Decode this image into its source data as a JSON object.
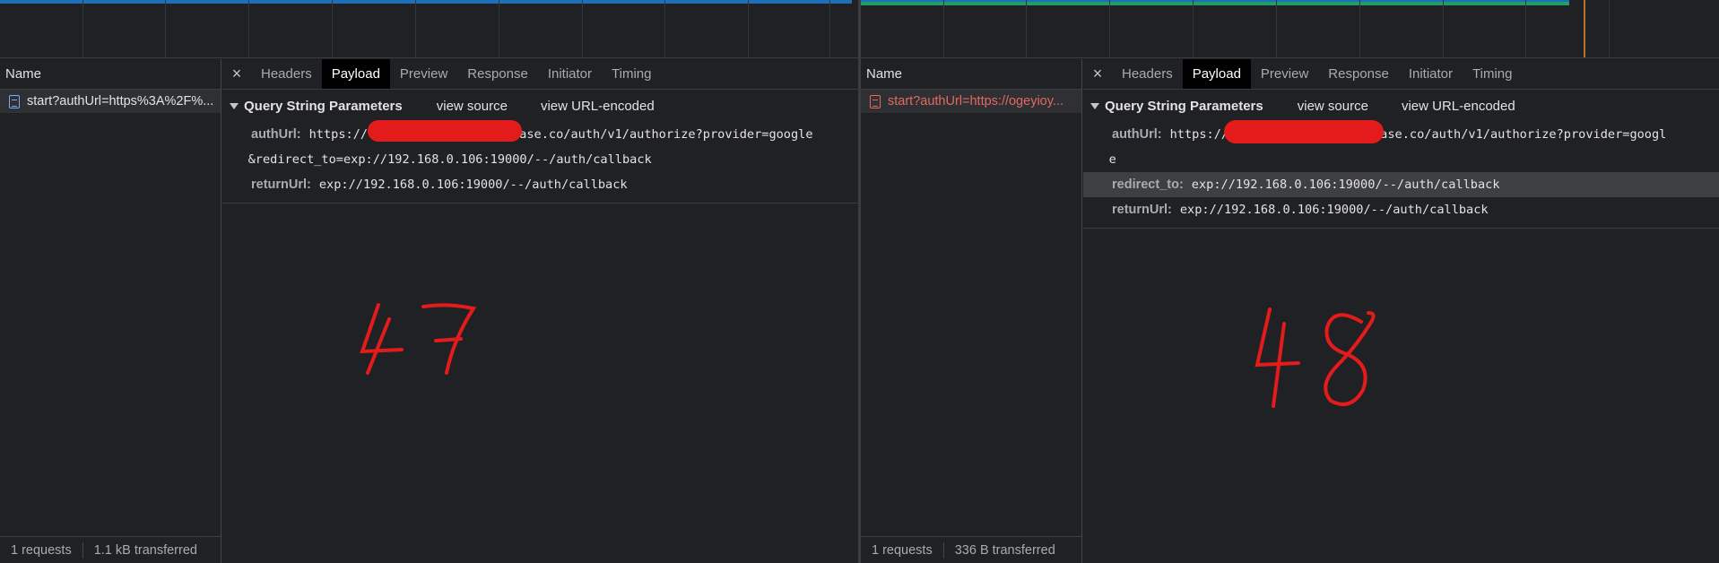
{
  "left": {
    "name_header": "Name",
    "request": {
      "label": "start?authUrl=https%3A%2F%..."
    },
    "status": {
      "requests": "1 requests",
      "transferred": "1.1 kB transferred"
    },
    "tabs": {
      "close": "×",
      "headers": "Headers",
      "payload": "Payload",
      "preview": "Preview",
      "response": "Response",
      "initiator": "Initiator",
      "timing": "Timing"
    },
    "section": {
      "title": "Query String Parameters",
      "view_source": "view source",
      "view_encoded": "view URL-encoded"
    },
    "params": {
      "auth_key": "authUrl:",
      "auth_val_1": "https://",
      "auth_val_2": ".supabase.co/auth/v1/authorize?provider=google",
      "auth_val_3": "&redirect_to=exp://192.168.0.106:19000/--/auth/callback",
      "return_key": "returnUrl:",
      "return_val": "exp://192.168.0.106:19000/--/auth/callback"
    },
    "annotation": "47"
  },
  "right": {
    "name_header": "Name",
    "request": {
      "label": "start?authUrl=https://ogeyioy..."
    },
    "status": {
      "requests": "1 requests",
      "transferred": "336 B transferred"
    },
    "tabs": {
      "close": "×",
      "headers": "Headers",
      "payload": "Payload",
      "preview": "Preview",
      "response": "Response",
      "initiator": "Initiator",
      "timing": "Timing"
    },
    "section": {
      "title": "Query String Parameters",
      "view_source": "view source",
      "view_encoded": "view URL-encoded"
    },
    "params": {
      "auth_key": "authUrl:",
      "auth_val_1": "https://",
      "auth_val_2": ".supabase.co/auth/v1/authorize?provider=googl",
      "auth_val_3": "e",
      "redirect_key": "redirect_to:",
      "redirect_val": "exp://192.168.0.106:19000/--/auth/callback",
      "return_key": "returnUrl:",
      "return_val": "exp://192.168.0.106:19000/--/auth/callback"
    },
    "annotation": "48"
  },
  "colors": {
    "background": "#202124",
    "active_tab": "#000000",
    "error_text": "#e46962",
    "redaction": "#e41b1b",
    "timeline_blue": "#1f6fb5",
    "timeline_green": "#1e9e6b"
  },
  "icons": {
    "request": "document-icon",
    "collapse": "triangle-down-icon"
  }
}
